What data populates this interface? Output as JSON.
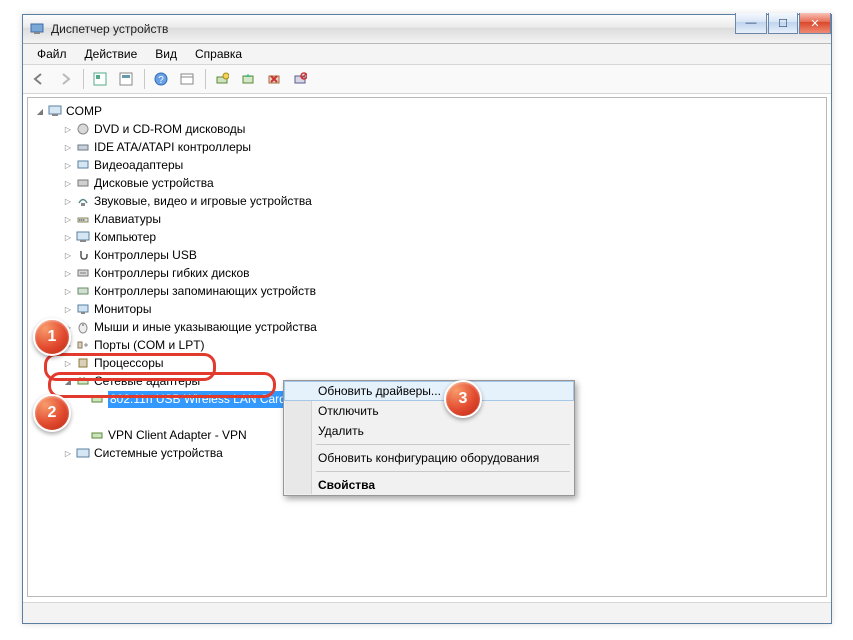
{
  "title": "Диспетчер устройств",
  "menu": {
    "file": "Файл",
    "action": "Действие",
    "view": "Вид",
    "help": "Справка"
  },
  "tree": {
    "root": "COMP",
    "items": [
      "DVD и CD-ROM дисководы",
      "IDE ATA/ATAPI контроллеры",
      "Видеоадаптеры",
      "Дисковые устройства",
      "Звуковые, видео и игровые устройства",
      "Клавиатуры",
      "Компьютер",
      "Контроллеры USB",
      "Контроллеры гибких дисков",
      "Контроллеры запоминающих устройств",
      "Мониторы",
      "Мыши и иные указывающие устройства",
      "Порты (COM и LPT)"
    ],
    "processors": "Процессоры",
    "net_adapters": "Сетевые адаптеры",
    "selected": "802.11n USB Wireless LAN Card",
    "item_hidden": "",
    "vpn": "VPN Client Adapter - VPN",
    "system_devices": "Системные устройства"
  },
  "context_menu": {
    "update": "Обновить драйверы...",
    "disable": "Отключить",
    "remove": "Удалить",
    "rescan": "Обновить конфигурацию оборудования",
    "properties": "Свойства"
  },
  "steps": {
    "s1": "1",
    "s2": "2",
    "s3": "3"
  },
  "winbtns": {
    "min": "—",
    "max": "☐",
    "close": "✕"
  }
}
